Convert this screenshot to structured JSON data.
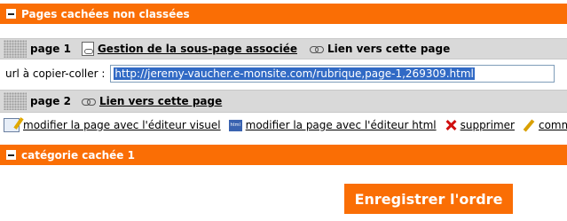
{
  "unclassified_section": {
    "title": "Pages cachées non classées"
  },
  "pages": [
    {
      "name": "page 1",
      "links": [
        "Gestion de la sous-page associée",
        "Lien vers cette page"
      ]
    },
    {
      "name": "page 2",
      "links": [
        "Lien vers cette page"
      ]
    }
  ],
  "url_row": {
    "label": "url à copier-coller :",
    "value": "http://jeremy-vaucher.e-monsite.com/rubrique,page-1,269309.html"
  },
  "actions": [
    {
      "label": "modifier la page avec l'éditeur visuel",
      "icon": "edit-visual-icon"
    },
    {
      "label": "modifier la page avec l'éditeur html",
      "icon": "html-editor-icon"
    },
    {
      "label": "supprimer",
      "icon": "delete-icon"
    },
    {
      "label": "comme",
      "icon": "comment-pen-icon"
    }
  ],
  "hidden_category": {
    "title": "catégorie cachée 1"
  },
  "save_order_button": {
    "label": "Enregistrer l'ordre"
  },
  "colors": {
    "accent": "#fa6e05",
    "row_bg": "#d9d9d9",
    "selection": "#316ac5"
  }
}
